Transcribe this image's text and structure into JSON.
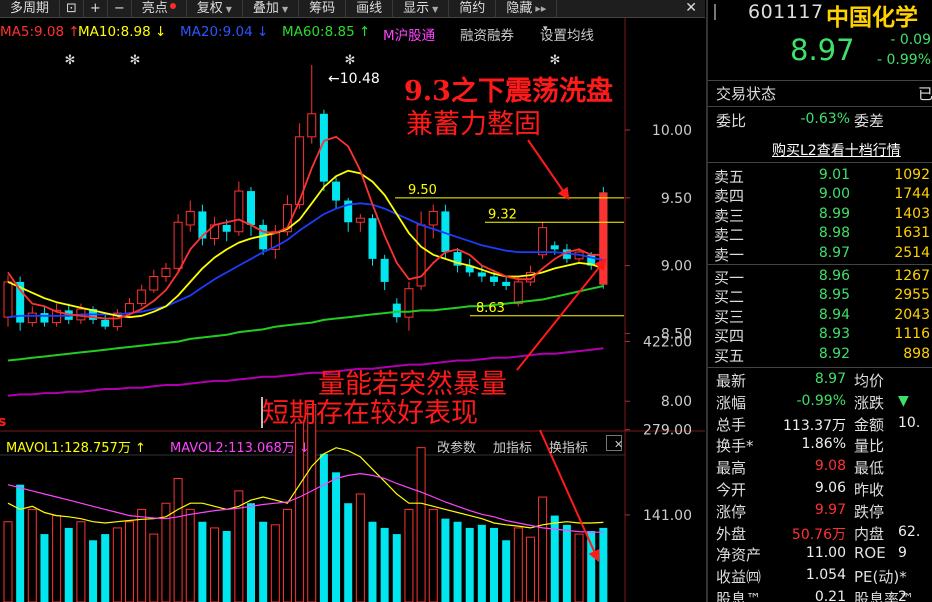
{
  "toolbar": {
    "period_label": "多周期",
    "tools": [
      "亮点",
      "复权",
      "叠加",
      "筹码",
      "画线",
      "显示",
      "简约",
      "隐藏"
    ],
    "zoom_in": "+",
    "zoom_out": "−",
    "close": "✕"
  },
  "ma_legend": {
    "ma5": "MA5:9.08 ↑",
    "ma10": "MA10:8.98 ↓",
    "ma20": "MA20:9.04 ↓",
    "ma60": "MA60:8.85 ↑",
    "m_hgt": "M沪股通",
    "margin": "融资融券",
    "set_ma": "设置均线"
  },
  "annotations": {
    "high_label": "←10.48",
    "note1_line1": "9.3之下震荡洗盘",
    "note1_line2": "兼蓄力整固",
    "note2_line1": "量能若突然暴量",
    "note2_line2": "短期存在较好表现",
    "line_950": "9.50",
    "line_932": "9.32",
    "line_863": "8.63"
  },
  "colors": {
    "up": "#ff3232",
    "down": "#00e5ee",
    "ma5": "#ffffff",
    "ma10": "#ffff00",
    "ma20": "#1c3cff",
    "ma60": "#22cc22",
    "ma_long": "#b000b0",
    "annotation": "#ff1a1a",
    "price_axis": "#cccccc"
  },
  "chart_data": [
    {
      "type": "candlestick",
      "title": "",
      "y_ticks": [
        "10.00",
        "9.50",
        "9.00",
        "8.50",
        "8.00"
      ],
      "ylim": [
        7.95,
        10.62
      ],
      "candles": [
        {
          "o": 8.62,
          "c": 8.88,
          "h": 8.93,
          "l": 8.55
        },
        {
          "o": 8.88,
          "c": 8.58,
          "h": 8.92,
          "l": 8.52
        },
        {
          "o": 8.58,
          "c": 8.65,
          "h": 8.7,
          "l": 8.55
        },
        {
          "o": 8.65,
          "c": 8.58,
          "h": 8.7,
          "l": 8.55
        },
        {
          "o": 8.58,
          "c": 8.67,
          "h": 8.72,
          "l": 8.55
        },
        {
          "o": 8.67,
          "c": 8.6,
          "h": 8.72,
          "l": 8.57
        },
        {
          "o": 8.6,
          "c": 8.68,
          "h": 8.72,
          "l": 8.57
        },
        {
          "o": 8.68,
          "c": 8.6,
          "h": 8.7,
          "l": 8.57
        },
        {
          "o": 8.6,
          "c": 8.55,
          "h": 8.64,
          "l": 8.53
        },
        {
          "o": 8.55,
          "c": 8.65,
          "h": 8.68,
          "l": 8.52
        },
        {
          "o": 8.65,
          "c": 8.72,
          "h": 8.76,
          "l": 8.62
        },
        {
          "o": 8.72,
          "c": 8.82,
          "h": 8.86,
          "l": 8.7
        },
        {
          "o": 8.82,
          "c": 8.92,
          "h": 8.97,
          "l": 8.8
        },
        {
          "o": 8.92,
          "c": 8.98,
          "h": 9.02,
          "l": 8.88
        },
        {
          "o": 8.98,
          "c": 9.32,
          "h": 9.38,
          "l": 8.96
        },
        {
          "o": 9.3,
          "c": 9.4,
          "h": 9.48,
          "l": 9.25
        },
        {
          "o": 9.4,
          "c": 9.2,
          "h": 9.45,
          "l": 9.15
        },
        {
          "o": 9.2,
          "c": 9.3,
          "h": 9.36,
          "l": 9.15
        },
        {
          "o": 9.3,
          "c": 9.25,
          "h": 9.34,
          "l": 9.18
        },
        {
          "o": 9.25,
          "c": 9.55,
          "h": 9.62,
          "l": 9.22
        },
        {
          "o": 9.55,
          "c": 9.3,
          "h": 9.58,
          "l": 9.22
        },
        {
          "o": 9.3,
          "c": 9.12,
          "h": 9.34,
          "l": 9.08
        },
        {
          "o": 9.12,
          "c": 9.25,
          "h": 9.3,
          "l": 9.05
        },
        {
          "o": 9.25,
          "c": 9.45,
          "h": 9.52,
          "l": 9.22
        },
        {
          "o": 9.45,
          "c": 9.95,
          "h": 10.05,
          "l": 9.42
        },
        {
          "o": 9.95,
          "c": 10.12,
          "h": 10.48,
          "l": 9.9
        },
        {
          "o": 10.12,
          "c": 9.62,
          "h": 10.15,
          "l": 9.55
        },
        {
          "o": 9.62,
          "c": 9.48,
          "h": 9.65,
          "l": 9.42
        },
        {
          "o": 9.48,
          "c": 9.32,
          "h": 9.5,
          "l": 9.25
        },
        {
          "o": 9.32,
          "c": 9.35,
          "h": 9.38,
          "l": 9.25
        },
        {
          "o": 9.35,
          "c": 9.05,
          "h": 9.38,
          "l": 9.0
        },
        {
          "o": 9.05,
          "c": 8.88,
          "h": 9.08,
          "l": 8.82
        },
        {
          "o": 8.72,
          "c": 8.62,
          "h": 8.76,
          "l": 8.58
        },
        {
          "o": 8.62,
          "c": 8.83,
          "h": 8.88,
          "l": 8.52
        },
        {
          "o": 8.85,
          "c": 9.3,
          "h": 9.4,
          "l": 8.82
        },
        {
          "o": 9.3,
          "c": 9.4,
          "h": 9.45,
          "l": 9.2
        },
        {
          "o": 9.4,
          "c": 9.1,
          "h": 9.45,
          "l": 9.05
        },
        {
          "o": 9.1,
          "c": 9.0,
          "h": 9.13,
          "l": 8.95
        },
        {
          "o": 9.0,
          "c": 8.95,
          "h": 9.05,
          "l": 8.92
        },
        {
          "o": 8.95,
          "c": 8.92,
          "h": 9.0,
          "l": 8.88
        },
        {
          "o": 8.92,
          "c": 8.88,
          "h": 8.97,
          "l": 8.85
        },
        {
          "o": 8.88,
          "c": 8.85,
          "h": 8.92,
          "l": 8.82
        },
        {
          "o": 8.72,
          "c": 8.88,
          "h": 8.92,
          "l": 8.7
        },
        {
          "o": 8.88,
          "c": 8.95,
          "h": 9.0,
          "l": 8.85
        },
        {
          "o": 9.08,
          "c": 9.28,
          "h": 9.32,
          "l": 9.05
        },
        {
          "o": 9.15,
          "c": 9.12,
          "h": 9.18,
          "l": 9.08
        },
        {
          "o": 9.12,
          "c": 9.05,
          "h": 9.16,
          "l": 9.02
        },
        {
          "o": 9.05,
          "c": 9.1,
          "h": 9.13,
          "l": 9.02
        },
        {
          "o": 9.08,
          "c": 9.0,
          "h": 9.1,
          "l": 8.97
        },
        {
          "o": 9.54,
          "c": 8.86,
          "h": 9.58,
          "l": 8.83
        }
      ],
      "ma5": [
        8.95,
        8.82,
        8.72,
        8.7,
        8.66,
        8.64,
        8.63,
        8.62,
        8.61,
        8.61,
        8.64,
        8.68,
        8.74,
        8.82,
        8.95,
        9.12,
        9.22,
        9.3,
        9.32,
        9.34,
        9.3,
        9.25,
        9.24,
        9.28,
        9.48,
        9.72,
        9.92,
        9.95,
        9.88,
        9.7,
        9.45,
        9.22,
        9.02,
        8.9,
        8.92,
        9.02,
        9.1,
        9.12,
        9.08,
        9.0,
        8.96,
        8.92,
        8.9,
        8.9,
        8.98,
        9.05,
        9.1,
        9.12,
        9.08,
        9.08
      ],
      "ma10": [
        8.88,
        8.84,
        8.8,
        8.76,
        8.73,
        8.71,
        8.69,
        8.67,
        8.65,
        8.63,
        8.62,
        8.63,
        8.66,
        8.7,
        8.78,
        8.88,
        8.98,
        9.06,
        9.12,
        9.17,
        9.2,
        9.22,
        9.24,
        9.27,
        9.34,
        9.46,
        9.58,
        9.66,
        9.7,
        9.68,
        9.62,
        9.52,
        9.38,
        9.24,
        9.14,
        9.08,
        9.05,
        9.02,
        9.0,
        8.97,
        8.94,
        8.92,
        8.92,
        8.93,
        8.95,
        8.98,
        9.0,
        9.02,
        9.01,
        8.98
      ],
      "ma20": [
        8.62,
        8.63,
        8.63,
        8.63,
        8.63,
        8.63,
        8.64,
        8.64,
        8.64,
        8.64,
        8.65,
        8.66,
        8.68,
        8.7,
        8.74,
        8.78,
        8.84,
        8.9,
        8.95,
        9.0,
        9.05,
        9.1,
        9.14,
        9.19,
        9.26,
        9.32,
        9.38,
        9.42,
        9.45,
        9.46,
        9.45,
        9.42,
        9.38,
        9.34,
        9.3,
        9.27,
        9.24,
        9.21,
        9.18,
        9.15,
        9.13,
        9.11,
        9.1,
        9.1,
        9.1,
        9.1,
        9.09,
        9.08,
        9.06,
        9.04
      ],
      "ma60": [
        8.3,
        8.31,
        8.32,
        8.33,
        8.34,
        8.35,
        8.36,
        8.37,
        8.38,
        8.39,
        8.4,
        8.41,
        8.42,
        8.43,
        8.44,
        8.46,
        8.47,
        8.48,
        8.49,
        8.51,
        8.52,
        8.53,
        8.55,
        8.56,
        8.57,
        8.58,
        8.6,
        8.61,
        8.62,
        8.63,
        8.64,
        8.65,
        8.66,
        8.66,
        8.67,
        8.67,
        8.68,
        8.69,
        8.7,
        8.7,
        8.71,
        8.72,
        8.73,
        8.74,
        8.75,
        8.77,
        8.79,
        8.81,
        8.83,
        8.85
      ],
      "ma_long": [
        8.04,
        8.05,
        8.05,
        8.06,
        8.06,
        8.07,
        8.07,
        8.08,
        8.09,
        8.09,
        8.1,
        8.1,
        8.11,
        8.12,
        8.12,
        8.13,
        8.14,
        8.15,
        8.15,
        8.16,
        8.17,
        8.18,
        8.18,
        8.19,
        8.2,
        8.21,
        8.21,
        8.22,
        8.23,
        8.24,
        8.24,
        8.25,
        8.26,
        8.27,
        8.27,
        8.28,
        8.29,
        8.3,
        8.3,
        8.31,
        8.32,
        8.32,
        8.33,
        8.34,
        8.35,
        8.35,
        8.36,
        8.37,
        8.38,
        8.39
      ],
      "levels": [
        9.5,
        9.32,
        8.63
      ]
    },
    {
      "type": "bar",
      "title": "",
      "legend": [
        "MAVOL1:128.757万 ↑",
        "MAVOL2:113.068万 ↓"
      ],
      "y_ticks": [
        "422.00",
        "279.00",
        "141.00"
      ],
      "ylim": [
        0,
        460
      ],
      "values": [
        130,
        190,
        150,
        110,
        140,
        120,
        130,
        100,
        110,
        120,
        130,
        150,
        110,
        160,
        200,
        150,
        130,
        120,
        115,
        180,
        160,
        130,
        125,
        150,
        290,
        320,
        240,
        210,
        160,
        175,
        130,
        120,
        110,
        150,
        250,
        150,
        135,
        130,
        120,
        125,
        120,
        100,
        120,
        105,
        170,
        140,
        125,
        110,
        115,
        120
      ],
      "mavol1": [
        160,
        150,
        155,
        145,
        140,
        138,
        135,
        130,
        128,
        130,
        132,
        134,
        135,
        138,
        150,
        160,
        160,
        155,
        150,
        155,
        165,
        170,
        165,
        160,
        190,
        220,
        240,
        250,
        245,
        235,
        215,
        195,
        175,
        160,
        160,
        155,
        150,
        145,
        140,
        135,
        128,
        125,
        123,
        120,
        125,
        128,
        130,
        128,
        128,
        129
      ],
      "mavol2": [
        190,
        185,
        180,
        175,
        170,
        165,
        160,
        155,
        150,
        145,
        140,
        138,
        136,
        135,
        138,
        142,
        145,
        148,
        150,
        152,
        155,
        158,
        160,
        162,
        170,
        180,
        190,
        200,
        205,
        208,
        205,
        200,
        192,
        185,
        178,
        170,
        162,
        155,
        148,
        142,
        138,
        132,
        128,
        124,
        120,
        118,
        116,
        114,
        113,
        113
      ]
    }
  ],
  "vol_panel": {
    "params": "改参数",
    "add_indicator": "加指标",
    "switch_indicator": "换指标",
    "close": "✕"
  },
  "quote": {
    "code": "601117",
    "name": "中国化学",
    "price": "8.97",
    "change": "- 0.09",
    "pct": "- 0.99%",
    "status_label": "交易状态",
    "status_value": "已",
    "webi_label": "委比",
    "webi_value": "-0.63%",
    "wecha_label": "委差",
    "l2_link": "购买L2查看十档行情",
    "asks": [
      {
        "label": "卖五",
        "price": "9.01",
        "vol": "1092"
      },
      {
        "label": "卖四",
        "price": "9.00",
        "vol": "1744"
      },
      {
        "label": "卖三",
        "price": "8.99",
        "vol": "1403"
      },
      {
        "label": "卖二",
        "price": "8.98",
        "vol": "1631"
      },
      {
        "label": "卖一",
        "price": "8.97",
        "vol": "2514"
      }
    ],
    "bids": [
      {
        "label": "买一",
        "price": "8.96",
        "vol": "1267"
      },
      {
        "label": "买二",
        "price": "8.95",
        "vol": "2955"
      },
      {
        "label": "买三",
        "price": "8.94",
        "vol": "2043"
      },
      {
        "label": "买四",
        "price": "8.93",
        "vol": "1116"
      },
      {
        "label": "买五",
        "price": "8.92",
        "vol": "898"
      }
    ],
    "stats": [
      {
        "l1": "最新",
        "v1": "8.97",
        "c1": "green",
        "l2": "均价",
        "v2": ""
      },
      {
        "l1": "涨幅",
        "v1": "-0.99%",
        "c1": "green",
        "l2": "涨跌",
        "v2": "▼"
      },
      {
        "l1": "总手",
        "v1": "113.37万",
        "c1": "white",
        "l2": "金额",
        "v2": "10."
      },
      {
        "l1": "换手*",
        "v1": "1.86%",
        "c1": "white",
        "l2": "量比",
        "v2": ""
      },
      {
        "l1": "最高",
        "v1": "9.08",
        "c1": "red",
        "l2": "最低",
        "v2": ""
      },
      {
        "l1": "今开",
        "v1": "9.06",
        "c1": "white",
        "l2": "昨收",
        "v2": ""
      },
      {
        "l1": "涨停",
        "v1": "9.97",
        "c1": "red",
        "l2": "跌停",
        "v2": ""
      },
      {
        "l1": "外盘",
        "v1": "50.76万",
        "c1": "red",
        "l2": "内盘",
        "v2": "62."
      },
      {
        "l1": "净资产",
        "v1": "11.00",
        "c1": "white",
        "l2": "ROE",
        "v2": "9"
      },
      {
        "l1": "收益㈣",
        "v1": "1.054",
        "c1": "white",
        "l2": "PE(动)*",
        "v2": ""
      },
      {
        "l1": "股息™",
        "v1": "0.21",
        "c1": "white",
        "l2": "股息率™",
        "v2": "2"
      }
    ]
  }
}
